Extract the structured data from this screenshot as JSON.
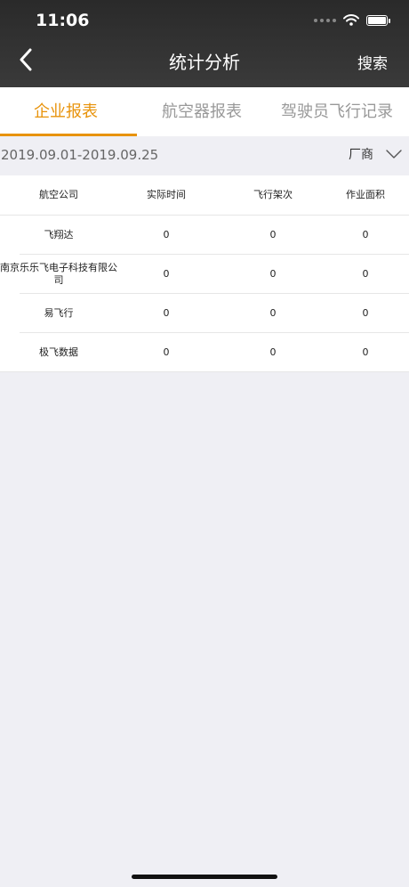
{
  "status_bar": {
    "time": "11:06"
  },
  "nav": {
    "title": "统计分析",
    "search_label": "搜索"
  },
  "tabs": [
    {
      "label": "企业报表",
      "active": true
    },
    {
      "label": "航空器报表",
      "active": false
    },
    {
      "label": "驾驶员飞行记录",
      "active": false
    }
  ],
  "filter": {
    "date_range": "2019.09.01-2019.09.25",
    "vendor_label": "厂商"
  },
  "table": {
    "columns": [
      "航空公司",
      "实际时间",
      "飞行架次",
      "作业面积"
    ],
    "rows": [
      {
        "company": "飞翔达",
        "time": "0",
        "flights": "0",
        "area": "0"
      },
      {
        "company": "南京乐乐飞电子科技有限公司",
        "time": "0",
        "flights": "0",
        "area": "0"
      },
      {
        "company": "易飞行",
        "time": "0",
        "flights": "0",
        "area": "0"
      },
      {
        "company": "极飞数据",
        "time": "0",
        "flights": "0",
        "area": "0"
      }
    ]
  },
  "colors": {
    "accent": "#e8930b",
    "header_bg": "#2f2f2f",
    "page_bg": "#efeff4"
  }
}
